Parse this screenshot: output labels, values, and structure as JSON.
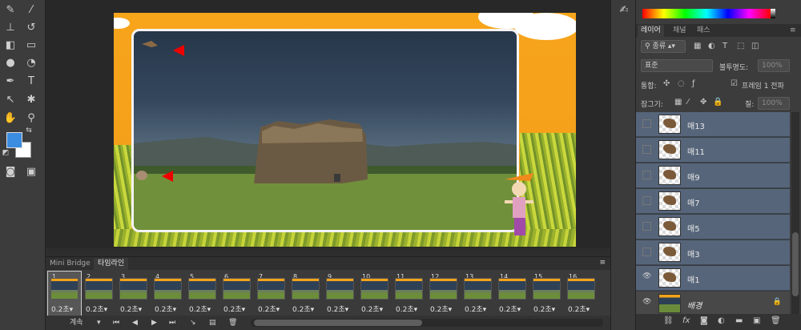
{
  "toolbox": {
    "tools": [
      "brush-icon",
      "pencil-icon",
      "stamp-icon",
      "history-brush-icon",
      "eraser-icon",
      "gradient-icon",
      "blur-icon",
      "dodge-icon",
      "pen-icon",
      "text-icon",
      "path-select-icon",
      "custom-shape-icon",
      "hand-icon",
      "zoom-icon"
    ],
    "text_tool_glyph": "T",
    "foreground_color": "#3b8de0",
    "background_color": "#ffffff"
  },
  "timeline": {
    "tabs": [
      "Mini Bridge",
      "타임라인"
    ],
    "active_tab": 1,
    "frames": [
      {
        "num": "1",
        "delay": "0.2초"
      },
      {
        "num": "2",
        "delay": "0.2초"
      },
      {
        "num": "3",
        "delay": "0.2초"
      },
      {
        "num": "4",
        "delay": "0.2초"
      },
      {
        "num": "5",
        "delay": "0.2초"
      },
      {
        "num": "6",
        "delay": "0.2초"
      },
      {
        "num": "7",
        "delay": "0.2초"
      },
      {
        "num": "8",
        "delay": "0.2초"
      },
      {
        "num": "9",
        "delay": "0.2초"
      },
      {
        "num": "10",
        "delay": "0.2초"
      },
      {
        "num": "11",
        "delay": "0.2초"
      },
      {
        "num": "12",
        "delay": "0.2초"
      },
      {
        "num": "13",
        "delay": "0.2초"
      },
      {
        "num": "14",
        "delay": "0.2초"
      },
      {
        "num": "15",
        "delay": "0.2초"
      },
      {
        "num": "16",
        "delay": "0.2초"
      }
    ],
    "selected_frame": 0,
    "loop_label": "계속",
    "controls": [
      "first-frame-icon",
      "prev-frame-icon",
      "play-icon",
      "next-frame-icon",
      "tween-icon",
      "duplicate-frame-icon",
      "delete-frame-icon"
    ]
  },
  "layers_panel": {
    "tabs": [
      "레이어",
      "채널",
      "패스"
    ],
    "active_tab": 0,
    "filter_kind": "종류",
    "blend_mode": "표준",
    "opacity_label": "불투명도:",
    "opacity_value": "100%",
    "unify_label": "통합:",
    "propagate_label": "프레임 1 전파",
    "lock_label": "잠그기:",
    "fill_label": "칠:",
    "fill_value": "100%",
    "layers": [
      {
        "name": "매13",
        "visible": false,
        "selected": true,
        "thumb": "bird"
      },
      {
        "name": "매11",
        "visible": false,
        "selected": true,
        "thumb": "bird"
      },
      {
        "name": "매9",
        "visible": false,
        "selected": true,
        "thumb": "bird"
      },
      {
        "name": "매7",
        "visible": false,
        "selected": true,
        "thumb": "bird"
      },
      {
        "name": "매5",
        "visible": false,
        "selected": true,
        "thumb": "bird"
      },
      {
        "name": "매3",
        "visible": false,
        "selected": true,
        "thumb": "bird"
      },
      {
        "name": "매1",
        "visible": true,
        "selected": true,
        "thumb": "bird"
      },
      {
        "name": "배경",
        "visible": true,
        "selected": false,
        "thumb": "bg",
        "locked": true
      }
    ],
    "footer": [
      "link-icon",
      "fx-icon",
      "mask-icon",
      "adjustment-icon",
      "group-icon",
      "new-layer-icon",
      "trash-icon"
    ]
  },
  "colors": {
    "selection": "#56657a",
    "panel": "#3c3c3c",
    "marker": "#e00000"
  }
}
